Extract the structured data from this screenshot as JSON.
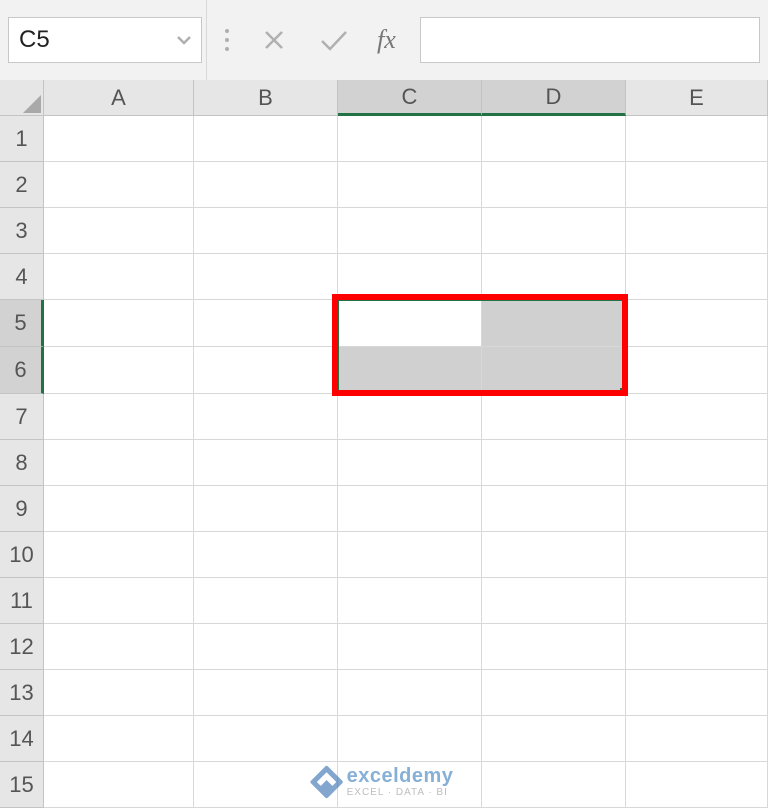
{
  "formula_bar": {
    "name_box_value": "C5",
    "cancel_tooltip": "Cancel",
    "enter_tooltip": "Enter",
    "fx_label": "fx",
    "formula_value": ""
  },
  "columns": [
    {
      "label": "A",
      "width": 150,
      "selected": false
    },
    {
      "label": "B",
      "width": 144,
      "selected": false
    },
    {
      "label": "C",
      "width": 144,
      "selected": true
    },
    {
      "label": "D",
      "width": 144,
      "selected": true
    },
    {
      "label": "E",
      "width": 142,
      "selected": false
    }
  ],
  "rows": [
    {
      "label": "1",
      "height": 46,
      "selected": false
    },
    {
      "label": "2",
      "height": 46,
      "selected": false
    },
    {
      "label": "3",
      "height": 46,
      "selected": false
    },
    {
      "label": "4",
      "height": 46,
      "selected": false
    },
    {
      "label": "5",
      "height": 47,
      "selected": true
    },
    {
      "label": "6",
      "height": 47,
      "selected": true
    },
    {
      "label": "7",
      "height": 46,
      "selected": false
    },
    {
      "label": "8",
      "height": 46,
      "selected": false
    },
    {
      "label": "9",
      "height": 46,
      "selected": false
    },
    {
      "label": "10",
      "height": 46,
      "selected": false
    },
    {
      "label": "11",
      "height": 46,
      "selected": false
    },
    {
      "label": "12",
      "height": 46,
      "selected": false
    },
    {
      "label": "13",
      "height": 46,
      "selected": false
    },
    {
      "label": "14",
      "height": 46,
      "selected": false
    },
    {
      "label": "15",
      "height": 46,
      "selected": false
    }
  ],
  "selection": {
    "active_cell": "C5",
    "range": "C5:D6",
    "start_col_index": 2,
    "end_col_index": 3,
    "start_row_index": 4,
    "end_row_index": 5
  },
  "highlight_annotation": {
    "range": "C5:D6"
  },
  "watermark": {
    "title": "exceldemy",
    "subtitle": "EXCEL · DATA · BI"
  }
}
